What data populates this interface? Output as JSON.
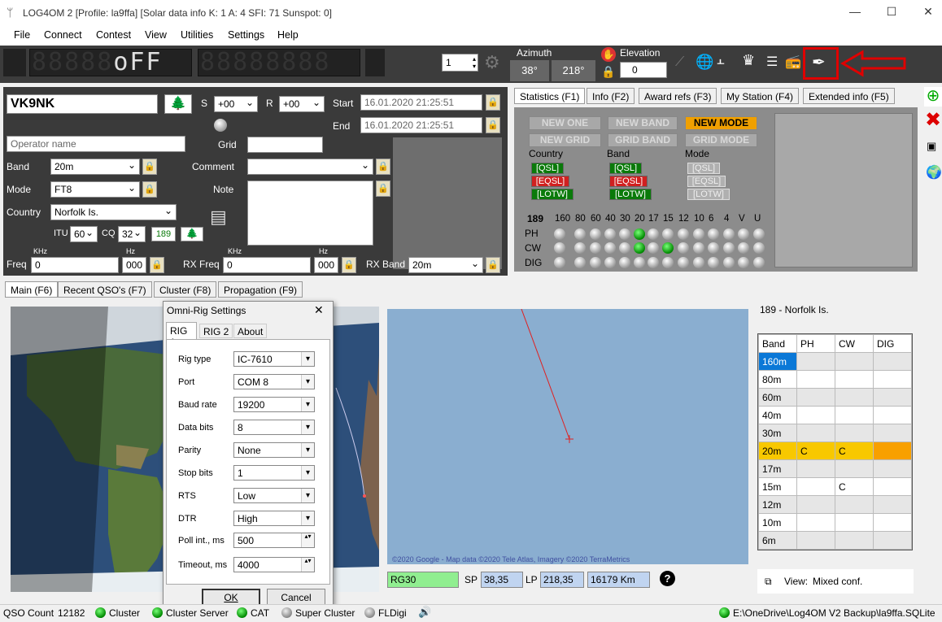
{
  "window": {
    "title": "LOG4OM 2 [Profile: la9ffa] [Solar data info K: 1 A: 4 SFI: 71 Sunspot: 0]",
    "min": "—",
    "max": "☐",
    "close": "✕"
  },
  "menu": [
    "File",
    "Connect",
    "Contest",
    "View",
    "Utilities",
    "Settings",
    "Help"
  ],
  "toolbar": {
    "lcd1_dim": "88888",
    "lcd1_on": "oFF",
    "lcd2": "88888888",
    "rig_num": "1",
    "azimuth_label": "Azimuth",
    "azimuth_sp": "38°",
    "azimuth_lp": "218°",
    "elevation_label": "Elevation",
    "elevation_value": "0"
  },
  "qso": {
    "callsign": "VK9NK",
    "s_label": "S",
    "s_value": "+00",
    "r_label": "R",
    "r_value": "+00",
    "start_label": "Start",
    "start_value": "16.01.2020 21:25:51",
    "end_label": "End",
    "end_value": "16.01.2020 21:25:51",
    "operator_placeholder": "Operator name",
    "grid_label": "Grid",
    "band_label": "Band",
    "band_value": "20m",
    "comment_label": "Comment",
    "mode_label": "Mode",
    "mode_value": "FT8",
    "note_label": "Note",
    "country_label": "Country",
    "country_value": "Norfolk Is.",
    "itu_label": "ITU",
    "itu_value": "60",
    "cq_label": "CQ",
    "cq_value": "32",
    "dxcc": "189",
    "khz1": "KHz",
    "hz1": "Hz",
    "khz2": "KHz",
    "hz2": "Hz",
    "freq_label": "Freq",
    "freq_value": "0",
    "freq_hz": "000",
    "rxfreq_label": "RX Freq",
    "rxfreq_value": "0",
    "rxfreq_hz": "000",
    "rxband_label": "RX Band",
    "rxband_value": "20m"
  },
  "info_tabs": [
    "Statistics (F1)",
    "Info (F2)",
    "Award refs (F3)",
    "My Station (F4)",
    "Extended info (F5)"
  ],
  "stats": {
    "buttons": [
      "NEW ONE",
      "NEW BAND",
      "NEW MODE",
      "NEW GRID",
      "GRID BAND",
      "GRID MODE"
    ],
    "col_labels": [
      "Country",
      "Band",
      "Mode"
    ],
    "qsl": "[QSL]",
    "eqsl": "[EQSL]",
    "lotw": "[LOTW]",
    "dxcc": "189",
    "bands": [
      "160",
      "80",
      "60",
      "40",
      "30",
      "20",
      "17",
      "15",
      "12",
      "10",
      "6",
      "4",
      "V",
      "U"
    ],
    "rows": [
      "PH",
      "CW",
      "DIG"
    ]
  },
  "main_tabs": [
    "Main (F6)",
    "Recent QSO's (F7)",
    "Cluster (F8)",
    "Propagation (F9)"
  ],
  "dialog": {
    "title": "Omni-Rig Settings",
    "close": "✕",
    "tabs": [
      "RIG 1",
      "RIG 2",
      "About"
    ],
    "fields": [
      {
        "label": "Rig type",
        "value": "IC-7610"
      },
      {
        "label": "Port",
        "value": "COM 8"
      },
      {
        "label": "Baud rate",
        "value": "19200"
      },
      {
        "label": "Data bits",
        "value": "8"
      },
      {
        "label": "Parity",
        "value": "None"
      },
      {
        "label": "Stop bits",
        "value": "1"
      },
      {
        "label": "RTS",
        "value": "Low"
      },
      {
        "label": "DTR",
        "value": "High"
      },
      {
        "label": "Poll int., ms",
        "value": "500"
      },
      {
        "label": "Timeout, ms",
        "value": "4000"
      }
    ],
    "ok": "OK",
    "cancel": "Cancel"
  },
  "map": {
    "copyright": "©2020 Google - Map data ©2020 Tele Atlas, Imagery ©2020 TerraMetrics",
    "grid": "RG30",
    "sp_label": "SP",
    "sp_value": "38,35",
    "lp_label": "LP",
    "lp_value": "218,35",
    "distance": "16179 Km",
    "help": "?"
  },
  "band_table": {
    "title": "189 - Norfolk Is.",
    "headers": [
      "Band",
      "PH",
      "CW",
      "DIG"
    ],
    "rows": [
      [
        "160m",
        "",
        "",
        ""
      ],
      [
        "80m",
        "",
        "",
        ""
      ],
      [
        "60m",
        "",
        "",
        ""
      ],
      [
        "40m",
        "",
        "",
        ""
      ],
      [
        "30m",
        "",
        "",
        ""
      ],
      [
        "20m",
        "C",
        "C",
        ""
      ],
      [
        "17m",
        "",
        "",
        ""
      ],
      [
        "15m",
        "",
        "C",
        ""
      ],
      [
        "12m",
        "",
        "",
        ""
      ],
      [
        "10m",
        "",
        "",
        ""
      ],
      [
        "6m",
        "",
        "",
        ""
      ]
    ],
    "view_label": "View:",
    "view_value": "Mixed conf."
  },
  "status": {
    "qso_count_label": "QSO Count",
    "qso_count": "12182",
    "items": [
      "Cluster",
      "Cluster Server",
      "CAT",
      "Super Cluster",
      "FLDigi"
    ],
    "db_path": "E:\\OneDrive\\Log4OM V2 Backup\\la9ffa.SQLite"
  },
  "colors": {
    "highlight_row": "#f8c800",
    "dig_cell": "#f8a000",
    "selected_band": "#0a78d7",
    "map_water": "#8aaed0",
    "arrow": "#e00000"
  }
}
